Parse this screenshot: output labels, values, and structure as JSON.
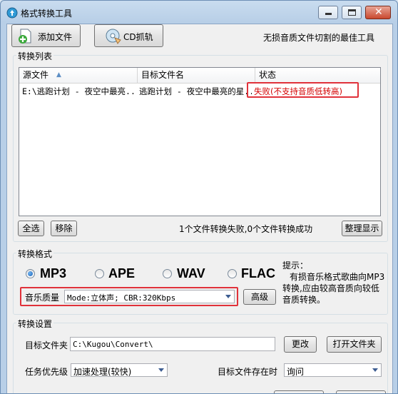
{
  "window": {
    "title": "格式转换工具"
  },
  "toolbar": {
    "add_file": "添加文件",
    "cd_rip": "CD抓轨",
    "slogan": "无损音质文件切割的最佳工具"
  },
  "convert_list": {
    "group_label": "转换列表",
    "columns": [
      "源文件",
      "目标文件名",
      "状态"
    ],
    "rows": [
      {
        "source": "E:\\逃跑计划 - 夜空中最亮...",
        "target": "逃跑计划 - 夜空中最亮的星...",
        "status": "失败(不支持音质低转高)"
      }
    ],
    "select_all": "全选",
    "remove": "移除",
    "summary": "1个文件转换失败,0个文件转换成功",
    "tidy": "整理显示"
  },
  "format": {
    "group_label": "转换格式",
    "options": [
      "MP3",
      "APE",
      "WAV",
      "FLAC"
    ],
    "selected": "MP3",
    "quality_label": "音乐质量",
    "quality_value": "Mode:立体声; CBR:320Kbps",
    "advanced": "高级",
    "hint_title": "提示：",
    "hint_body": "有损音乐格式歌曲向MP3转换,应由较高音质向较低音质转换。"
  },
  "settings": {
    "group_label": "转换设置",
    "target_folder_label": "目标文件夹",
    "target_folder_value": "C:\\Kugou\\Convert\\",
    "change": "更改",
    "open_folder": "打开文件夹",
    "priority_label": "任务优先级",
    "priority_value": "加速处理(较快)",
    "exists_label": "目标文件存在时",
    "exists_value": "询问"
  },
  "colors": {
    "accent_red": "#e0313a",
    "status_red": "#d40000"
  }
}
